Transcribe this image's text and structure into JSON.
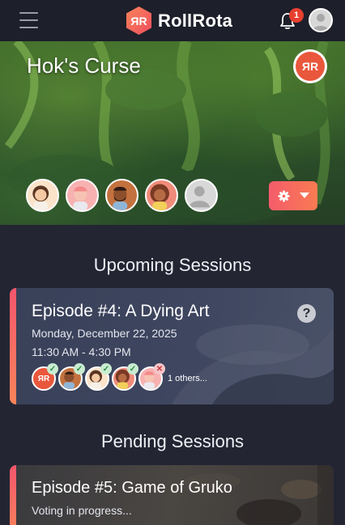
{
  "app": {
    "name": "RollRota",
    "logo_letters": "ЯR",
    "notifications_count": "1"
  },
  "campaign": {
    "title": "Hok's Curse",
    "logo_letters": "ЯR",
    "members": [
      "member-1",
      "member-2",
      "member-3",
      "member-4",
      "member-5"
    ]
  },
  "sections": {
    "upcoming": "Upcoming Sessions",
    "pending": "Pending Sessions"
  },
  "upcoming_session": {
    "title": "Episode #4: A Dying Art",
    "date": "Monday, December 22, 2025",
    "time": "11:30 AM - 4:30 PM",
    "help": "?",
    "attendee_logo": "ЯR",
    "others": "1 others..."
  },
  "pending_session": {
    "title": "Episode #5: Game of Gruko",
    "status": "Voting in progress..."
  },
  "colors": {
    "accent_start": "#f4566c",
    "accent_end": "#f9845a",
    "background": "#232533",
    "topbar": "#1d1f2a",
    "badge": "#e8402f"
  },
  "icons": [
    "hamburger-menu-icon",
    "bell-icon",
    "user-icon",
    "gear-icon",
    "caret-down-icon",
    "help-icon",
    "check-icon",
    "cross-icon"
  ]
}
